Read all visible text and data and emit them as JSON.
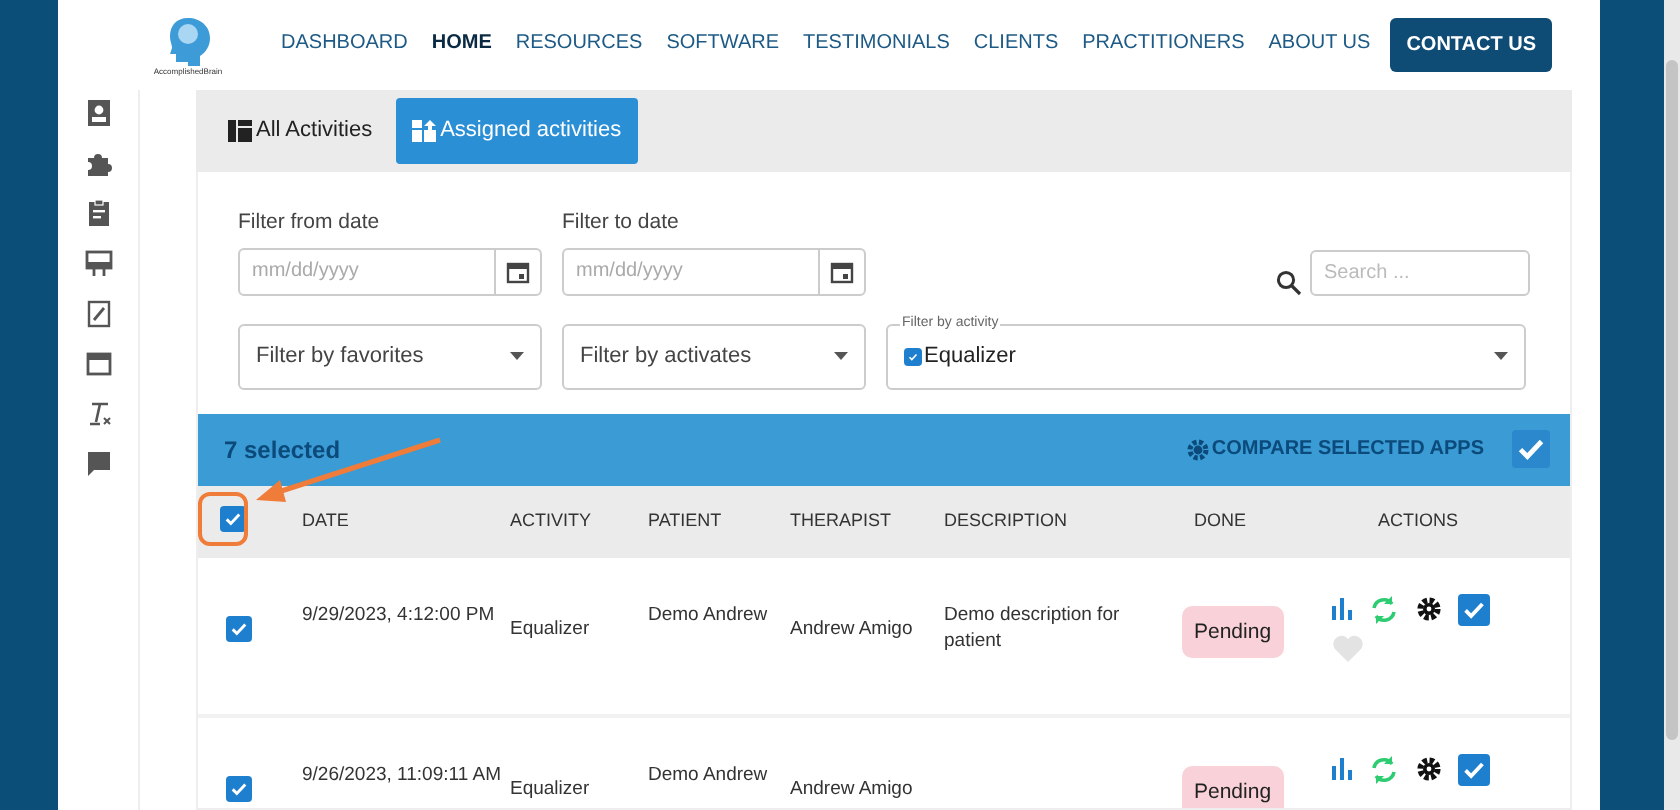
{
  "logo": {
    "caption": "AccomplishedBrain"
  },
  "nav": [
    {
      "label": "DASHBOARD",
      "selected": false,
      "kind": "link"
    },
    {
      "label": "HOME",
      "selected": true,
      "kind": "link"
    },
    {
      "label": "RESOURCES",
      "selected": false,
      "kind": "link"
    },
    {
      "label": "SOFTWARE",
      "selected": false,
      "kind": "link"
    },
    {
      "label": "TESTIMONIALS",
      "selected": false,
      "kind": "link"
    },
    {
      "label": "CLIENTS",
      "selected": false,
      "kind": "link"
    },
    {
      "label": "PRACTITIONERS",
      "selected": false,
      "kind": "link"
    },
    {
      "label": "ABOUT US",
      "selected": false,
      "kind": "link"
    },
    {
      "label": "CONTACT US",
      "kind": "button"
    }
  ],
  "tabs": [
    {
      "label": "All Activities",
      "selected": false
    },
    {
      "label": "Assigned activities",
      "selected": true
    }
  ],
  "date_filters": [
    {
      "label": "Filter from date",
      "placeholder": "mm/dd/yyyy"
    },
    {
      "label": "Filter to date",
      "placeholder": "mm/dd/yyyy"
    }
  ],
  "search": {
    "placeholder": "Search ..."
  },
  "selects": [
    {
      "placeholder": "Filter by favorites"
    },
    {
      "placeholder": "Filter by activates"
    },
    {
      "label": "Filter by activity",
      "value": "Equalizer",
      "checked": true
    }
  ],
  "selection_bar": {
    "count": "7 selected",
    "compare": "COMPARE SELECTED APPS",
    "checked": true
  },
  "table": {
    "select_all": true,
    "columns": [
      "DATE",
      "ACTIVITY",
      "PATIENT",
      "THERAPIST",
      "DESCRIPTION",
      "DONE",
      "ACTIONS"
    ],
    "rows": [
      {
        "selected": true,
        "date": "9/29/2023, 4:12:00 PM",
        "activity": "Equalizer",
        "patient": "Demo Andrew",
        "therapist": "Andrew Amigo",
        "description": "Demo description for patient",
        "done": "Pending",
        "checked": true,
        "favorite": false
      },
      {
        "selected": true,
        "date": "9/26/2023, 11:09:11 AM",
        "activity": "Equalizer",
        "patient": "Demo Andrew",
        "therapist": "Andrew Amigo",
        "done": "Pending",
        "checked": true
      }
    ]
  }
}
